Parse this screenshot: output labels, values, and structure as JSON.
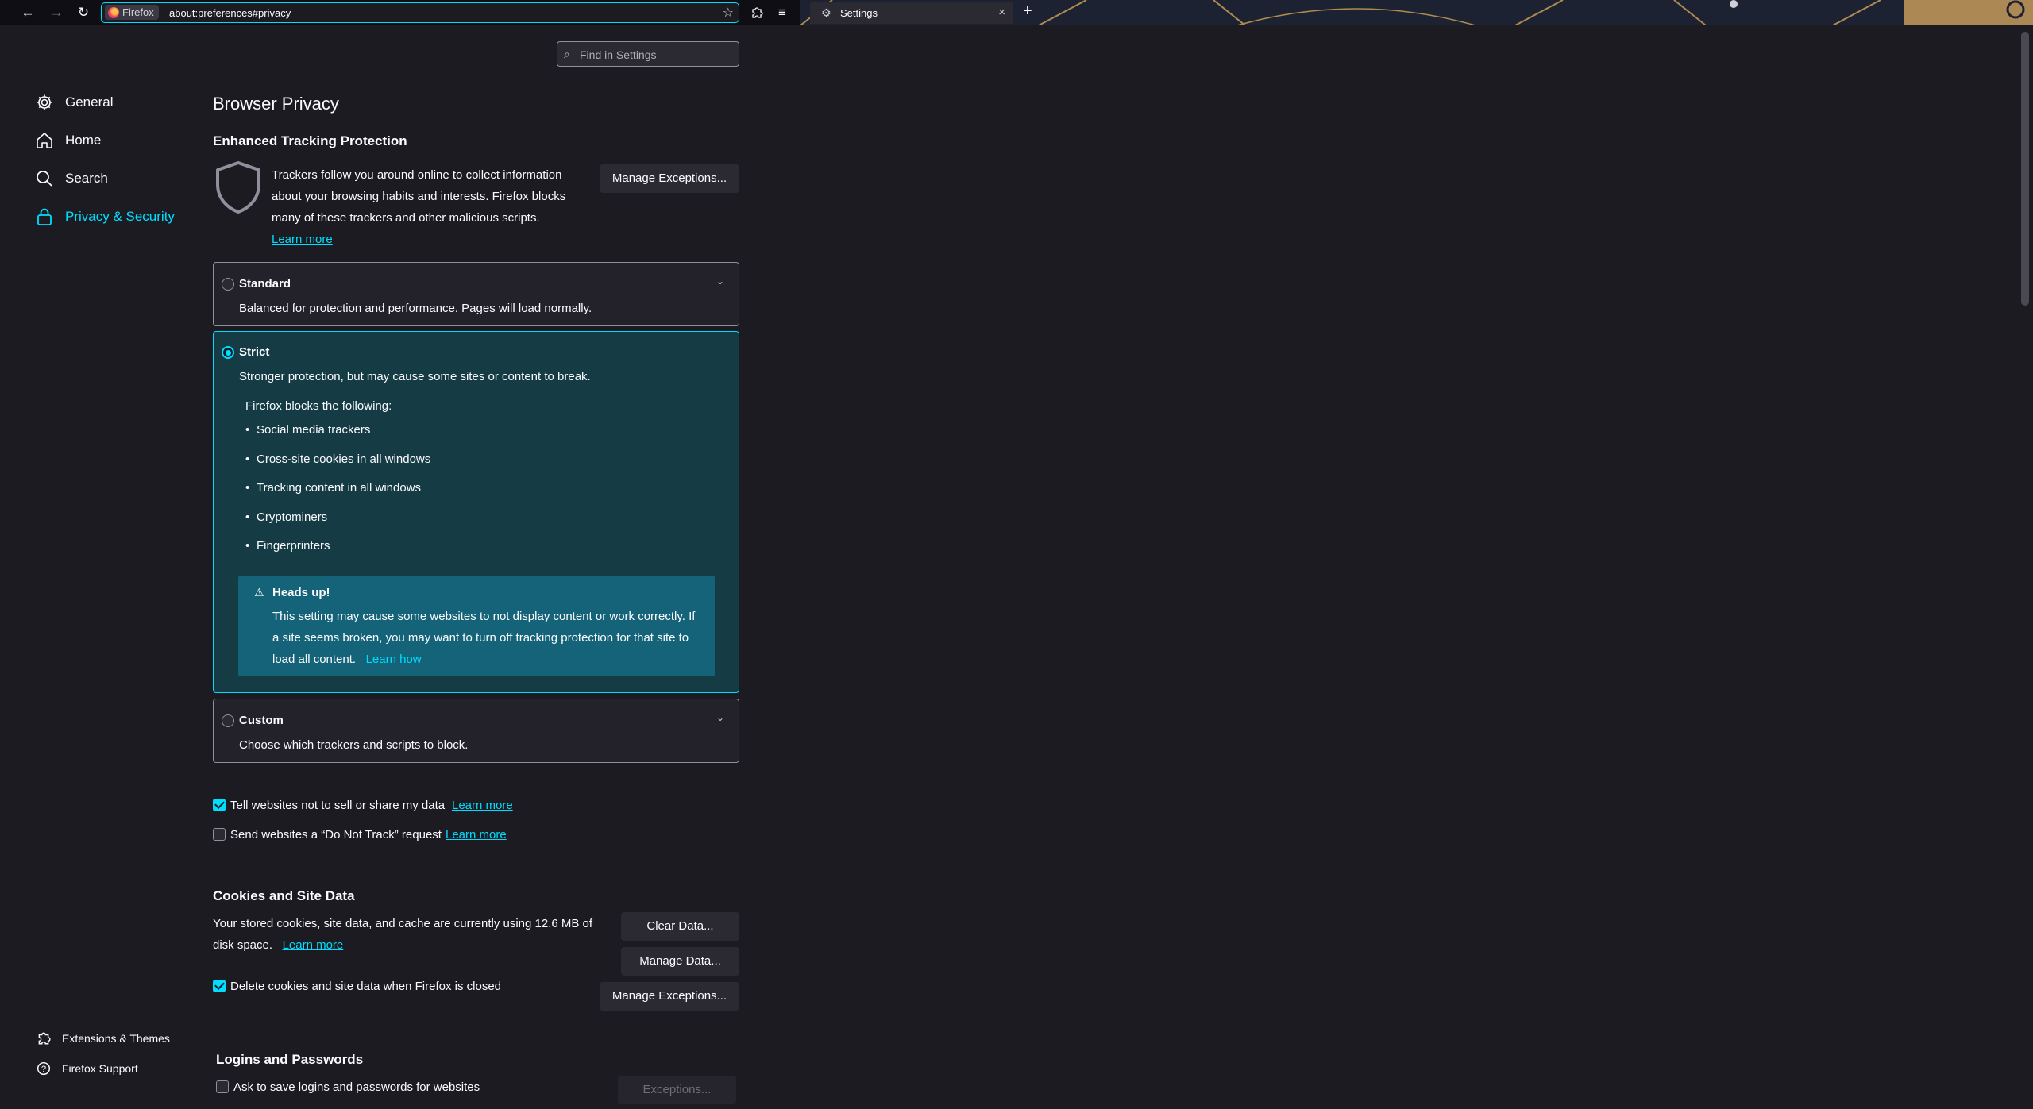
{
  "browser": {
    "identity_label": "Firefox",
    "url": "about:preferences#privacy",
    "tab_title": "Settings"
  },
  "sidebar": {
    "categories": [
      {
        "label": "General",
        "icon": "gear-icon"
      },
      {
        "label": "Home",
        "icon": "home-icon"
      },
      {
        "label": "Search",
        "icon": "search-icon"
      },
      {
        "label": "Privacy & Security",
        "icon": "lock-icon",
        "selected": true
      }
    ],
    "footer": [
      {
        "label": "Extensions & Themes",
        "icon": "puzzle-icon"
      },
      {
        "label": "Firefox Support",
        "icon": "help-icon"
      }
    ]
  },
  "search": {
    "placeholder": "Find in Settings"
  },
  "privacy": {
    "heading": "Browser Privacy",
    "etp": {
      "title": "Enhanced Tracking Protection",
      "description_lines": [
        "Trackers follow you around online to collect information",
        "about your browsing habits and interests. Firefox blocks",
        "many of these trackers and other malicious scripts."
      ],
      "learn_more": "Learn more",
      "manage_exceptions": "Manage Exceptions..."
    },
    "standard": {
      "title": "Standard",
      "description": "Balanced for protection and performance. Pages will load normally."
    },
    "strict": {
      "title": "Strict",
      "description": "Stronger protection, but may cause some sites or content to break.",
      "blocks_label": "Firefox blocks the following:",
      "items": [
        "Social media trackers",
        "Cross-site cookies in all windows",
        "Tracking content in all windows",
        "Cryptominers",
        "Fingerprinters"
      ],
      "warning_title": "Heads up!",
      "warning_lines": [
        "This setting may cause some websites to not display content or work correctly. If",
        "a site seems broken, you may want to turn off tracking protection for that site to",
        "load all content."
      ],
      "warning_link": "Learn how"
    },
    "custom": {
      "title": "Custom",
      "description": "Choose which trackers and scripts to block."
    },
    "gpc": {
      "label": "Tell websites not to sell or share my data",
      "link": "Learn more",
      "checked": true
    },
    "dnt": {
      "label": "Send websites a “Do Not Track” request",
      "link": "Learn more",
      "checked": false
    }
  },
  "cookies": {
    "title": "Cookies and Site Data",
    "line1": "Your stored cookies, site data, and cache are currently using 12.6 MB of",
    "line2": "disk space.",
    "learn_more": "Learn more",
    "clear_data": "Clear Data...",
    "manage_data": "Manage Data...",
    "manage_exceptions": "Manage Exceptions...",
    "delete_on_close": {
      "label": "Delete cookies and site data when Firefox is closed",
      "checked": true
    }
  },
  "logins": {
    "title": "Logins and Passwords",
    "ask_save": {
      "label": "Ask to save logins and passwords for websites",
      "checked": false
    },
    "exceptions": "Exceptions..."
  },
  "colors": {
    "accent": "#00ddff",
    "background": "#1c1b22",
    "selected_card": "#153c45"
  }
}
